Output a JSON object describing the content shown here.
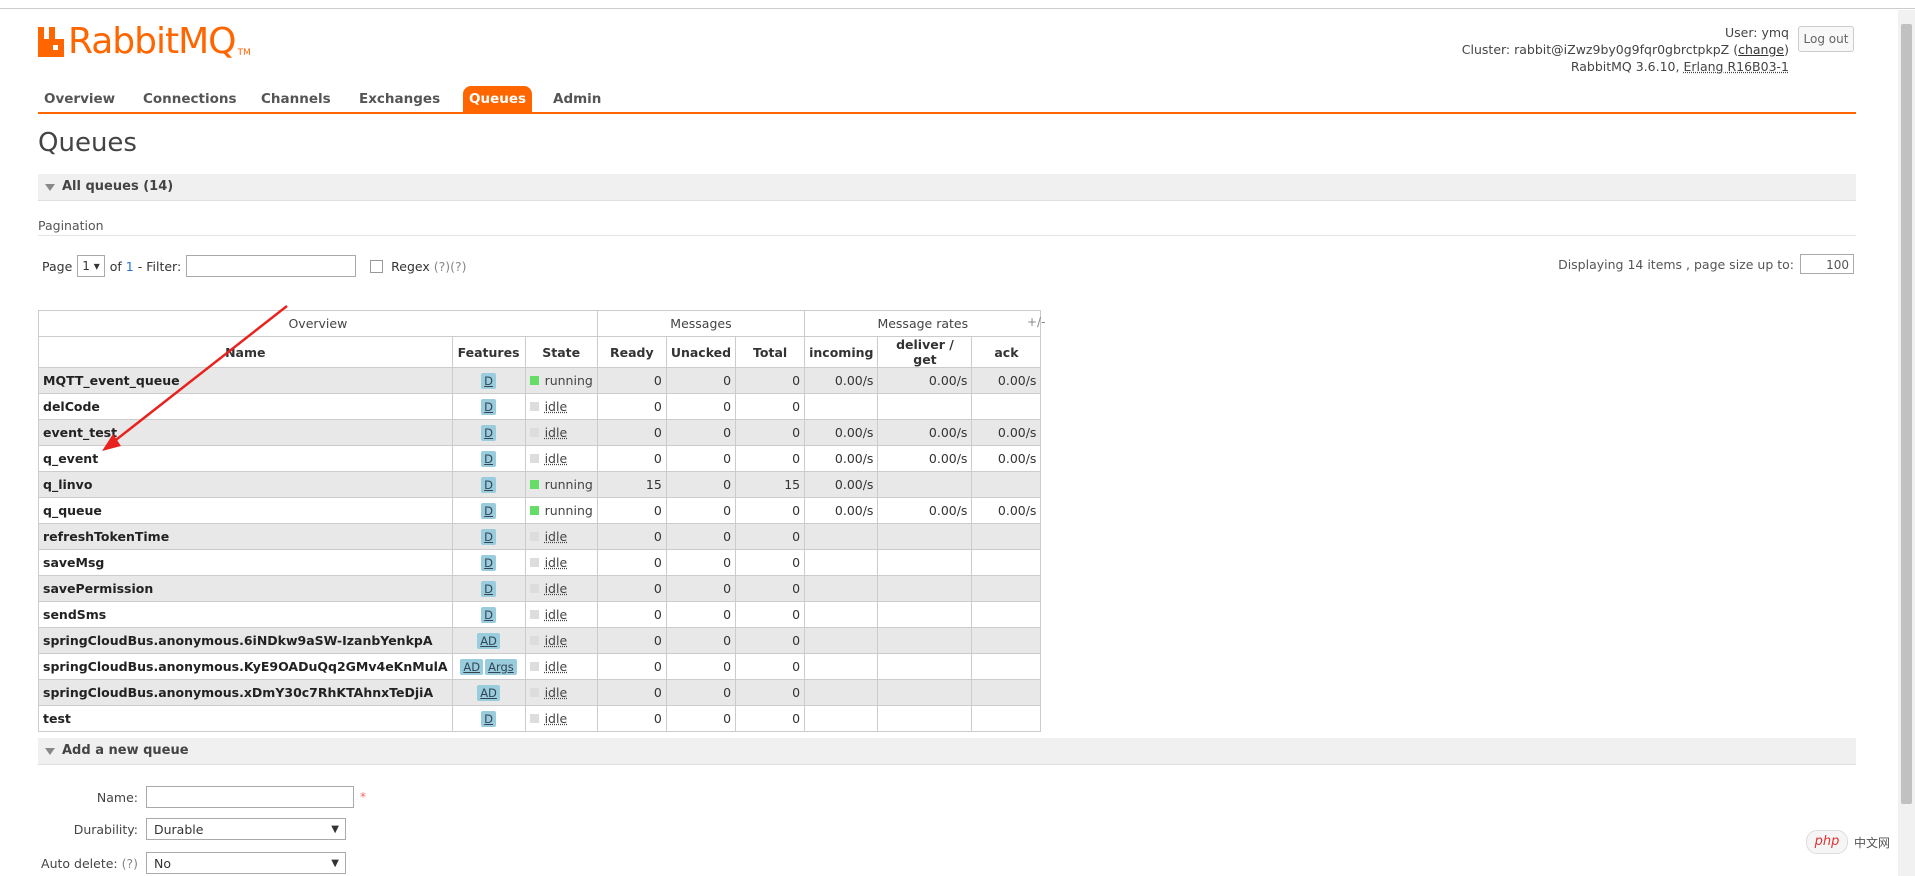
{
  "header": {
    "logo_text": "RabbitMQ",
    "logo_tm": "TM",
    "user_label": "User:",
    "user_name": "ymq",
    "cluster_label": "Cluster:",
    "cluster_name": "rabbit@iZwz9by0g9fqr0gbrctpkpZ",
    "change_link": "change",
    "version_text": "RabbitMQ 3.6.10,",
    "erlang_text": "Erlang R16B03-1",
    "logout_label": "Log out"
  },
  "tabs": [
    "Overview",
    "Connections",
    "Channels",
    "Exchanges",
    "Queues",
    "Admin"
  ],
  "active_tab": "Queues",
  "page_title": "Queues",
  "all_queues_header": "All queues (14)",
  "pagination": {
    "label": "Pagination",
    "page_label": "Page",
    "page_value": "1",
    "of_label": "of",
    "of_value": "1",
    "filter_label": "- Filter:",
    "regex_label": "Regex",
    "help1": "(?)",
    "help2": "(?)",
    "display_label": "Displaying 14 items , page size up to:",
    "page_size": "100"
  },
  "table": {
    "group_headers": [
      "Overview",
      "Messages",
      "Message rates"
    ],
    "plus_minus": "+/-",
    "columns": [
      "Name",
      "Features",
      "State",
      "Ready",
      "Unacked",
      "Total",
      "incoming",
      "deliver / get",
      "ack"
    ],
    "rows": [
      {
        "name": "MQTT_event_queue",
        "features": [
          "D"
        ],
        "state": "running",
        "ready": "0",
        "unacked": "0",
        "total": "0",
        "incoming": "0.00/s",
        "deliver": "0.00/s",
        "ack": "0.00/s"
      },
      {
        "name": "delCode",
        "features": [
          "D"
        ],
        "state": "idle",
        "ready": "0",
        "unacked": "0",
        "total": "0",
        "incoming": "",
        "deliver": "",
        "ack": ""
      },
      {
        "name": "event_test",
        "features": [
          "D"
        ],
        "state": "idle",
        "ready": "0",
        "unacked": "0",
        "total": "0",
        "incoming": "0.00/s",
        "deliver": "0.00/s",
        "ack": "0.00/s"
      },
      {
        "name": "q_event",
        "features": [
          "D"
        ],
        "state": "idle",
        "ready": "0",
        "unacked": "0",
        "total": "0",
        "incoming": "0.00/s",
        "deliver": "0.00/s",
        "ack": "0.00/s"
      },
      {
        "name": "q_linvo",
        "features": [
          "D"
        ],
        "state": "running",
        "ready": "15",
        "unacked": "0",
        "total": "15",
        "incoming": "0.00/s",
        "deliver": "",
        "ack": ""
      },
      {
        "name": "q_queue",
        "features": [
          "D"
        ],
        "state": "running",
        "ready": "0",
        "unacked": "0",
        "total": "0",
        "incoming": "0.00/s",
        "deliver": "0.00/s",
        "ack": "0.00/s"
      },
      {
        "name": "refreshTokenTime",
        "features": [
          "D"
        ],
        "state": "idle",
        "ready": "0",
        "unacked": "0",
        "total": "0",
        "incoming": "",
        "deliver": "",
        "ack": ""
      },
      {
        "name": "saveMsg",
        "features": [
          "D"
        ],
        "state": "idle",
        "ready": "0",
        "unacked": "0",
        "total": "0",
        "incoming": "",
        "deliver": "",
        "ack": ""
      },
      {
        "name": "savePermission",
        "features": [
          "D"
        ],
        "state": "idle",
        "ready": "0",
        "unacked": "0",
        "total": "0",
        "incoming": "",
        "deliver": "",
        "ack": ""
      },
      {
        "name": "sendSms",
        "features": [
          "D"
        ],
        "state": "idle",
        "ready": "0",
        "unacked": "0",
        "total": "0",
        "incoming": "",
        "deliver": "",
        "ack": ""
      },
      {
        "name": "springCloudBus.anonymous.6iNDkw9aSW-IzanbYenkpA",
        "features": [
          "AD"
        ],
        "state": "idle",
        "ready": "0",
        "unacked": "0",
        "total": "0",
        "incoming": "",
        "deliver": "",
        "ack": ""
      },
      {
        "name": "springCloudBus.anonymous.KyE9OADuQq2GMv4eKnMulA",
        "features": [
          "AD",
          "Args"
        ],
        "state": "idle",
        "ready": "0",
        "unacked": "0",
        "total": "0",
        "incoming": "",
        "deliver": "",
        "ack": ""
      },
      {
        "name": "springCloudBus.anonymous.xDmY30c7RhKTAhnxTeDjiA",
        "features": [
          "AD"
        ],
        "state": "idle",
        "ready": "0",
        "unacked": "0",
        "total": "0",
        "incoming": "",
        "deliver": "",
        "ack": ""
      },
      {
        "name": "test",
        "features": [
          "D"
        ],
        "state": "idle",
        "ready": "0",
        "unacked": "0",
        "total": "0",
        "incoming": "",
        "deliver": "",
        "ack": ""
      }
    ]
  },
  "add_queue": {
    "header": "Add a new queue",
    "name_label": "Name:",
    "required_mark": "*",
    "durability_label": "Durability:",
    "durability_value": "Durable",
    "auto_delete_label": "Auto delete:",
    "auto_delete_help": "(?)",
    "auto_delete_value": "No"
  },
  "watermark": {
    "badge": "php",
    "text": "中文网"
  },
  "colors": {
    "accent": "#ff6600",
    "running": "#66dd66",
    "idle": "#dddddd",
    "feature_badge": "#99ccdd",
    "arrow": "#e8231f"
  }
}
